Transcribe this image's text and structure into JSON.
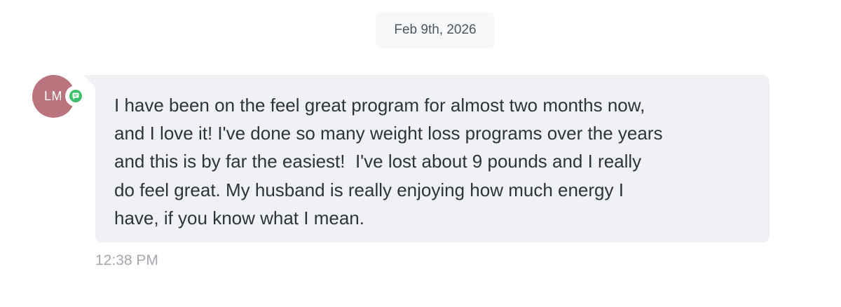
{
  "date_separator": "Feb 9th, 2026",
  "sender": {
    "initials": "LM",
    "avatar_color": "#b9747d",
    "channel_icon": "sms-chat-icon",
    "channel_color": "#3fbf6b"
  },
  "message": {
    "text": "I have been on the feel great program for almost two months now,\nand I love it! I've done so many weight loss programs over the years\nand this is by far the easiest!  I've lost about 9 pounds and I really\ndo feel great. My husband is really enjoying how much energy I\nhave, if you know what I mean.",
    "timestamp": "12:38 PM",
    "bubble_color": "#f0f1f5"
  }
}
